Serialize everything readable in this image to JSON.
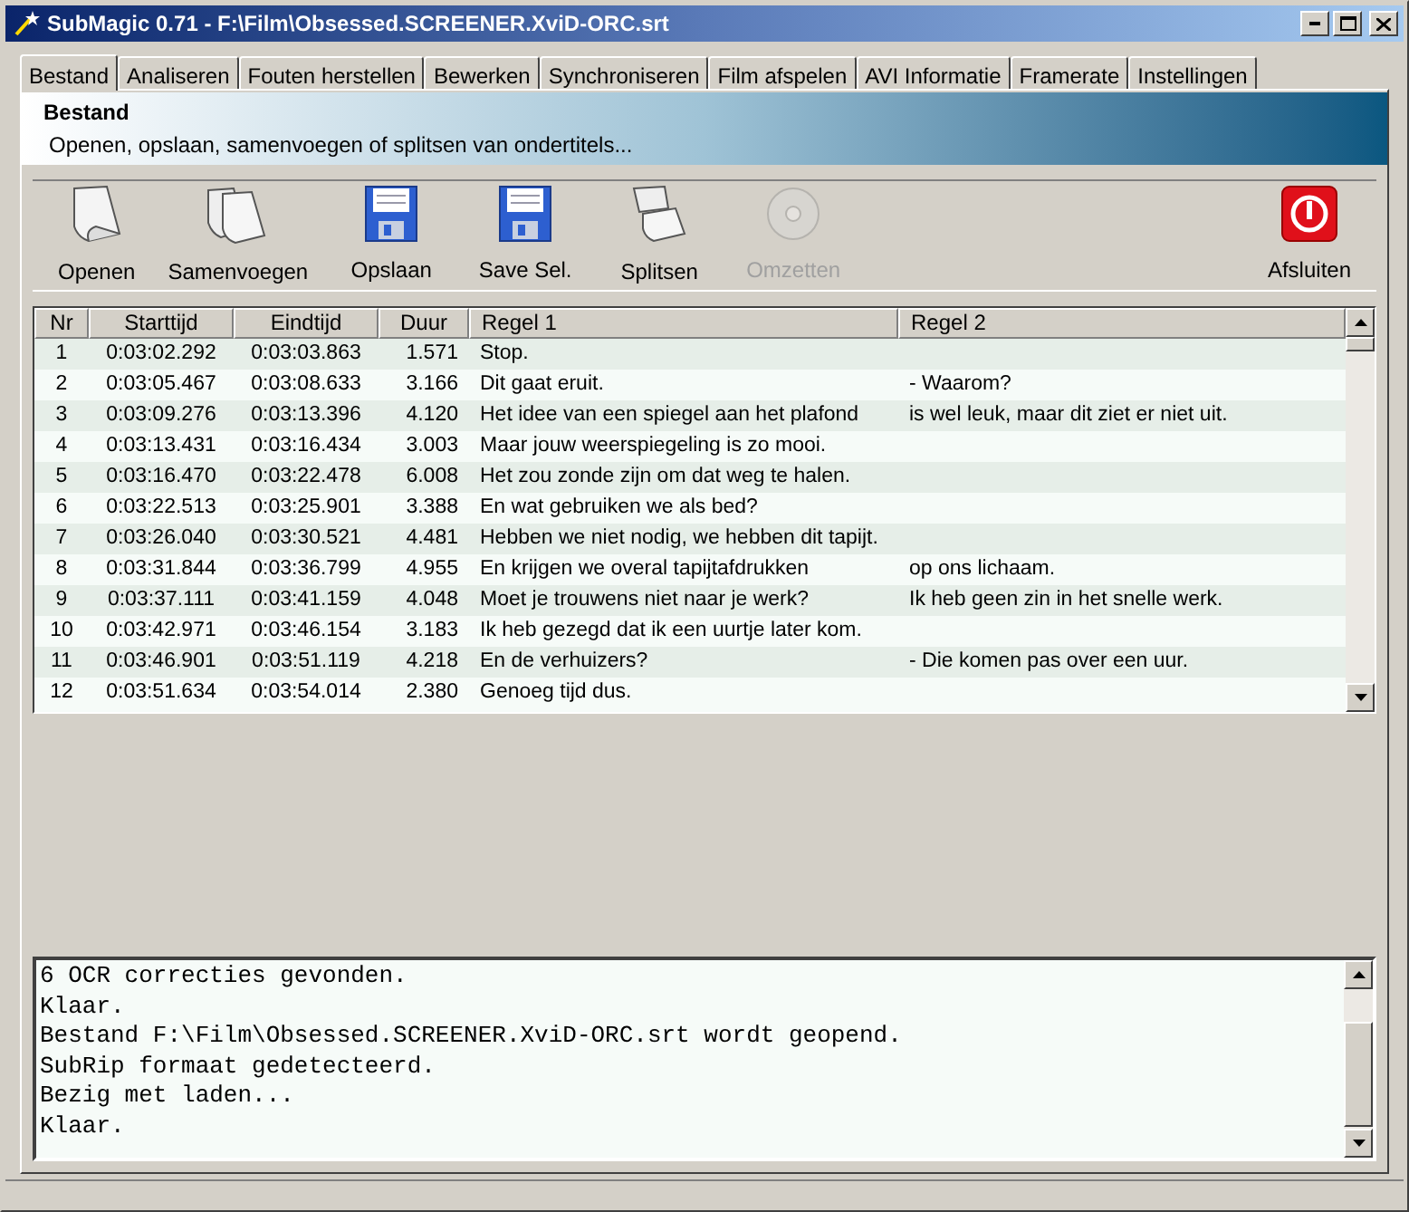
{
  "window": {
    "title": "SubMagic 0.71 - F:\\Film\\Obsessed.SCREENER.XviD-ORC.srt"
  },
  "tabs": [
    {
      "label": "Bestand",
      "selected": true
    },
    {
      "label": "Analiseren",
      "selected": false
    },
    {
      "label": "Fouten herstellen",
      "selected": false
    },
    {
      "label": "Bewerken",
      "selected": false
    },
    {
      "label": "Synchroniseren",
      "selected": false
    },
    {
      "label": "Film afspelen",
      "selected": false
    },
    {
      "label": "AVI Informatie",
      "selected": false
    },
    {
      "label": "Framerate",
      "selected": false
    },
    {
      "label": "Instellingen",
      "selected": false
    }
  ],
  "header": {
    "title": "Bestand",
    "subtitle": "Openen, opslaan, samenvoegen of splitsen van ondertitels..."
  },
  "toolbar": [
    {
      "label": "Openen",
      "kind": "document",
      "disabled": false
    },
    {
      "label": "Samenvoegen",
      "kind": "documents",
      "disabled": false
    },
    {
      "label": "Opslaan",
      "kind": "floppy",
      "disabled": false
    },
    {
      "label": "Save Sel.",
      "kind": "floppy",
      "disabled": false
    },
    {
      "label": "Splitsen",
      "kind": "split",
      "disabled": false
    },
    {
      "label": "Omzetten",
      "kind": "disc",
      "disabled": true
    },
    {
      "label": "Afsluiten",
      "kind": "power",
      "disabled": false
    }
  ],
  "table": {
    "columns": [
      "Nr",
      "Starttijd",
      "Eindtijd",
      "Duur",
      "Regel 1",
      "Regel 2"
    ],
    "rows": [
      [
        "1",
        "0:03:02.292",
        "0:03:03.863",
        "1.571",
        "Stop.",
        ""
      ],
      [
        "2",
        "0:03:05.467",
        "0:03:08.633",
        "3.166",
        "Dit gaat eruit.",
        "- Waarom?"
      ],
      [
        "3",
        "0:03:09.276",
        "0:03:13.396",
        "4.120",
        "Het idee van een spiegel aan het plafond",
        "is wel leuk, maar dit ziet er niet uit."
      ],
      [
        "4",
        "0:03:13.431",
        "0:03:16.434",
        "3.003",
        "Maar jouw weerspiegeling is zo mooi.",
        ""
      ],
      [
        "5",
        "0:03:16.470",
        "0:03:22.478",
        "6.008",
        "Het zou zonde zijn om dat weg te halen.",
        ""
      ],
      [
        "6",
        "0:03:22.513",
        "0:03:25.901",
        "3.388",
        "En wat gebruiken we als bed?",
        ""
      ],
      [
        "7",
        "0:03:26.040",
        "0:03:30.521",
        "4.481",
        "Hebben we niet nodig, we hebben dit tapijt.",
        ""
      ],
      [
        "8",
        "0:03:31.844",
        "0:03:36.799",
        "4.955",
        "En krijgen we overal tapijtafdrukken",
        "op ons lichaam."
      ],
      [
        "9",
        "0:03:37.111",
        "0:03:41.159",
        "4.048",
        "Moet je trouwens niet naar je werk?",
        "Ik heb geen zin in het snelle werk."
      ],
      [
        "10",
        "0:03:42.971",
        "0:03:46.154",
        "3.183",
        "Ik heb gezegd dat ik een uurtje later kom.",
        ""
      ],
      [
        "11",
        "0:03:46.901",
        "0:03:51.119",
        "4.218",
        "En de verhuizers?",
        "- Die komen pas over een uur."
      ],
      [
        "12",
        "0:03:51.634",
        "0:03:54.014",
        "2.380",
        "Genoeg tijd dus.",
        ""
      ]
    ]
  },
  "log": [
    "6 OCR correcties gevonden.",
    "Klaar.",
    "Bestand F:\\Film\\Obsessed.SCREENER.XviD-ORC.srt wordt geopend.",
    "SubRip formaat gedetecteerd.",
    "Bezig met laden...",
    "Klaar."
  ]
}
